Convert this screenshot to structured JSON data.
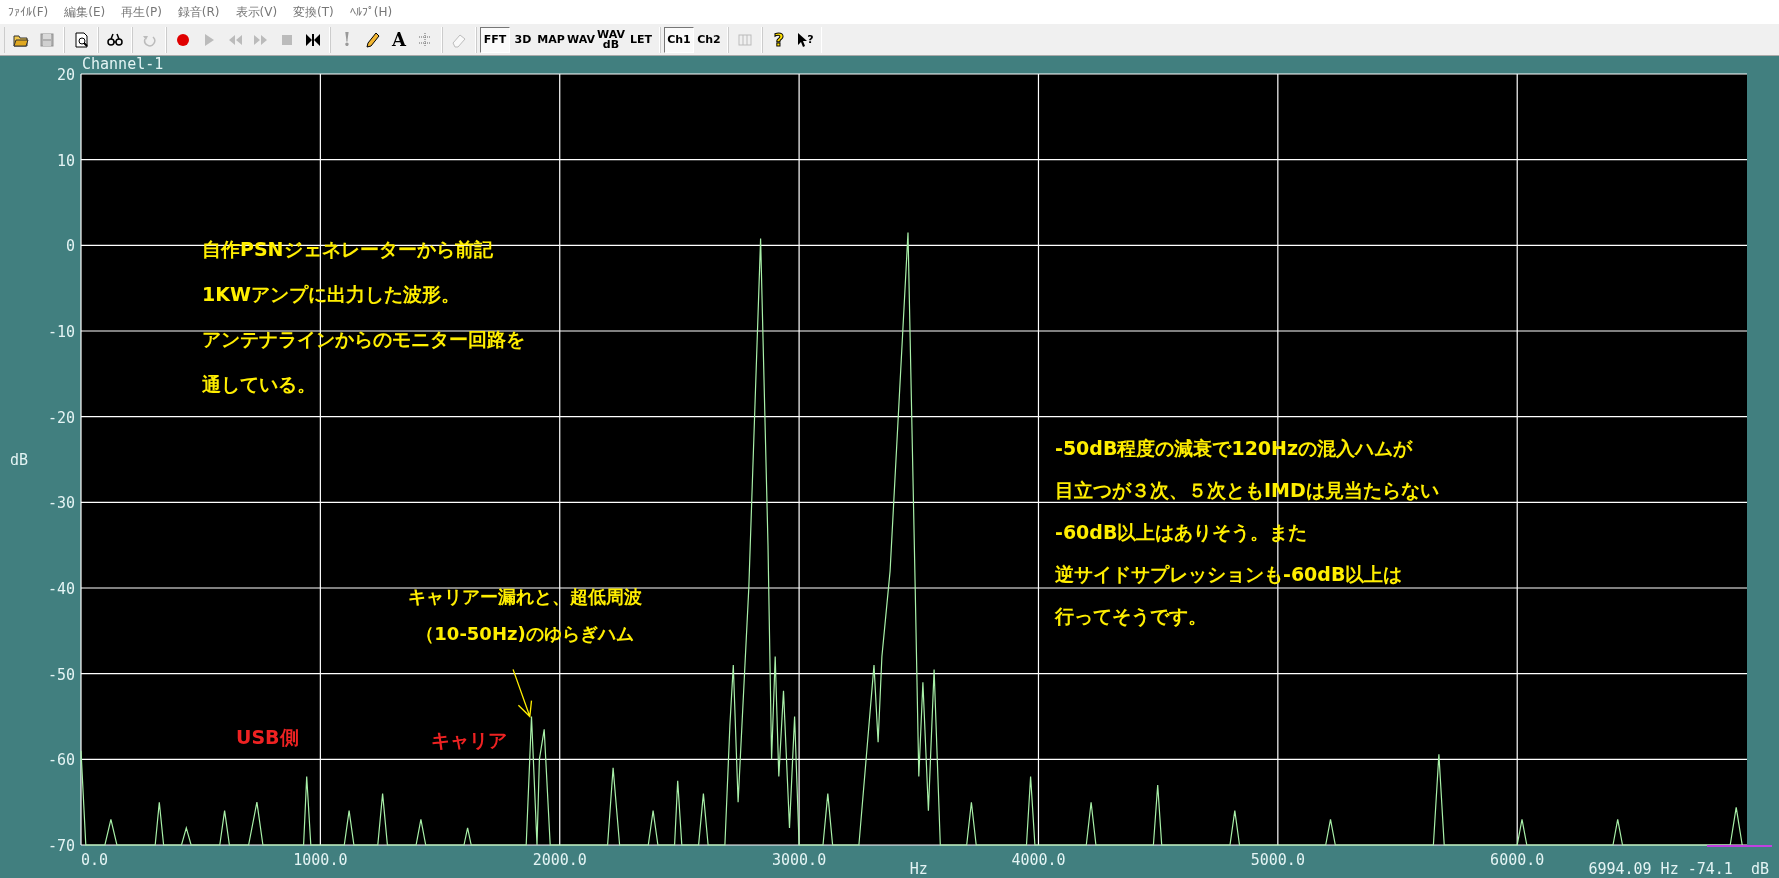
{
  "menu": [
    {
      "label": "ﾌｧｲﾙ(F)"
    },
    {
      "label": "編集(E)"
    },
    {
      "label": "再生(P)"
    },
    {
      "label": "録音(R)"
    },
    {
      "label": "表示(V)"
    },
    {
      "label": "変換(T)"
    },
    {
      "label": "ﾍﾙﾌﾟ(H)"
    }
  ],
  "toolbar": [
    [
      {
        "kind": "icon",
        "disabled": false,
        "selected": false
      },
      {
        "kind": "icon",
        "disabled": true,
        "selected": false
      }
    ],
    [
      {
        "kind": "icon",
        "disabled": false,
        "selected": false
      }
    ],
    [
      {
        "kind": "icon",
        "disabled": false,
        "selected": false
      }
    ],
    [
      {
        "kind": "icon",
        "disabled": true,
        "selected": false
      }
    ],
    [
      {
        "kind": "icon",
        "disabled": false,
        "selected": false
      },
      {
        "kind": "icon",
        "disabled": true,
        "selected": false
      },
      {
        "kind": "icon",
        "disabled": true,
        "selected": false
      },
      {
        "kind": "icon",
        "disabled": true,
        "selected": false
      },
      {
        "kind": "icon",
        "disabled": true,
        "selected": false
      },
      {
        "kind": "icon",
        "disabled": false,
        "selected": false
      }
    ],
    [
      {
        "kind": "text",
        "label": "!",
        "disabled": true,
        "selected": false
      },
      {
        "kind": "icon",
        "disabled": false,
        "selected": false
      },
      {
        "kind": "text",
        "label": "A",
        "disabled": false,
        "selected": false
      },
      {
        "kind": "icon",
        "disabled": false,
        "selected": false
      }
    ],
    [
      {
        "kind": "icon",
        "disabled": true,
        "selected": false
      }
    ],
    [
      {
        "kind": "text",
        "label": "FFT",
        "disabled": false,
        "selected": true
      },
      {
        "kind": "text",
        "label": "3D",
        "disabled": false,
        "selected": false
      },
      {
        "kind": "text",
        "label": "MAP",
        "disabled": false,
        "selected": false
      },
      {
        "kind": "text",
        "label": "WAV",
        "disabled": false,
        "selected": false
      },
      {
        "kind": "text",
        "label": "WAV\ndB",
        "disabled": false,
        "selected": false
      },
      {
        "kind": "text",
        "label": "LET",
        "disabled": false,
        "selected": false
      }
    ],
    [
      {
        "kind": "text",
        "label": "Ch1",
        "disabled": false,
        "selected": true
      },
      {
        "kind": "text",
        "label": "Ch2",
        "disabled": false,
        "selected": false
      }
    ],
    [
      {
        "kind": "icon",
        "disabled": true,
        "selected": false
      }
    ],
    [
      {
        "kind": "text",
        "label": "?",
        "disabled": false,
        "selected": false
      },
      {
        "kind": "icon",
        "label": "?",
        "disabled": false,
        "selected": false
      }
    ]
  ],
  "channel_title": "Channel-1",
  "readout": "6994.09 Hz -74.1  dB",
  "notes": [
    {
      "lines": [
        "自作PSNジェネレーターから前記",
        "1KWアンプに出力した波形。",
        "アンテナラインからのモニター回路を",
        "通している。"
      ],
      "color": "#ffee00"
    },
    {
      "lines": [
        "キャリアー漏れと、超低周波",
        "（10-50Hz)のゆらぎハム"
      ],
      "color": "#ffee00"
    },
    {
      "lines": [
        "USB側"
      ],
      "color": "#ee2222"
    },
    {
      "lines": [
        "キャリア"
      ],
      "color": "#ee2222"
    },
    {
      "lines": [
        "-50dB程度の減衰で120Hzの混入ハムが",
        "目立つが３次、５次ともIMDは見当たらない",
        "-60dB以上はありそう。また",
        "逆サイドサプレッションも-60dB以上は",
        "行ってそうです。"
      ],
      "color": "#ffee00"
    }
  ],
  "chart_data": {
    "type": "line",
    "grid": true,
    "xlabel": "Hz",
    "ylabel": "dB",
    "xlim": [
      0,
      6960
    ],
    "ylim": [
      -70,
      20
    ],
    "xticks": [
      {
        "value": 0,
        "label": "0.0"
      },
      {
        "value": 1000,
        "label": "1000.0"
      },
      {
        "value": 2000,
        "label": "2000.0"
      },
      {
        "value": 3000,
        "label": "3000.0"
      },
      {
        "value": 4000,
        "label": "4000.0"
      },
      {
        "value": 5000,
        "label": "5000.0"
      },
      {
        "value": 6000,
        "label": "6000.0"
      }
    ],
    "yticks": [
      -70,
      -60,
      -50,
      -40,
      -30,
      -20,
      -10,
      0,
      10,
      20
    ],
    "x": [
      0,
      20,
      100,
      125,
      150,
      310,
      327,
      345,
      420,
      440,
      460,
      580,
      600,
      620,
      700,
      735,
      760,
      930,
      943,
      960,
      1100,
      1120,
      1140,
      1240,
      1260,
      1280,
      1400,
      1420,
      1440,
      1600,
      1615,
      1630,
      1860,
      1882,
      1905,
      1915,
      1935,
      1960,
      2200,
      2223,
      2250,
      2370,
      2390,
      2410,
      2480,
      2493,
      2510,
      2580,
      2600,
      2620,
      2690,
      2711,
      2725,
      2745,
      2790,
      2839,
      2870,
      2885,
      2900,
      2915,
      2935,
      2960,
      2981,
      3000,
      3100,
      3120,
      3140,
      3250,
      3280,
      3313,
      3330,
      3346,
      3380,
      3455,
      3485,
      3500,
      3517,
      3540,
      3564,
      3590,
      3700,
      3720,
      3740,
      3950,
      3967,
      3985,
      4200,
      4220,
      4240,
      4480,
      4498,
      4515,
      4800,
      4820,
      4840,
      5200,
      5220,
      5240,
      5650,
      5673,
      5695,
      6000,
      6020,
      6040,
      6400,
      6420,
      6440,
      6890,
      6915,
      6940
    ],
    "series": [
      {
        "color": "#a8f0a8",
        "values": [
          -59,
          -70,
          -70,
          -67,
          -70,
          -70,
          -65,
          -70,
          -70,
          -68,
          -70,
          -70,
          -66,
          -70,
          -70,
          -65,
          -70,
          -70,
          -62,
          -70,
          -70,
          -66,
          -70,
          -70,
          -64,
          -70,
          -70,
          -67,
          -70,
          -70,
          -68,
          -70,
          -70,
          -55,
          -70,
          -60,
          -56.5,
          -70,
          -70,
          -61,
          -70,
          -70,
          -66,
          -70,
          -70,
          -62.5,
          -70,
          -70,
          -64,
          -70,
          -70,
          -56,
          -49,
          -65,
          -40,
          0.8,
          -35,
          -60,
          -48,
          -62,
          -52,
          -68,
          -55,
          -70,
          -70,
          -64,
          -70,
          -70,
          -60,
          -49,
          -58,
          -48,
          -38,
          1.5,
          -40,
          -62,
          -51,
          -66,
          -49.5,
          -70,
          -70,
          -65,
          -70,
          -70,
          -62,
          -70,
          -70,
          -65,
          -70,
          -70,
          -63,
          -70,
          -70,
          -66,
          -70,
          -70,
          -67,
          -70,
          -70,
          -59.4,
          -70,
          -70,
          -67,
          -70,
          -70,
          -67,
          -70,
          -70,
          -65.6,
          -70
        ]
      }
    ]
  }
}
